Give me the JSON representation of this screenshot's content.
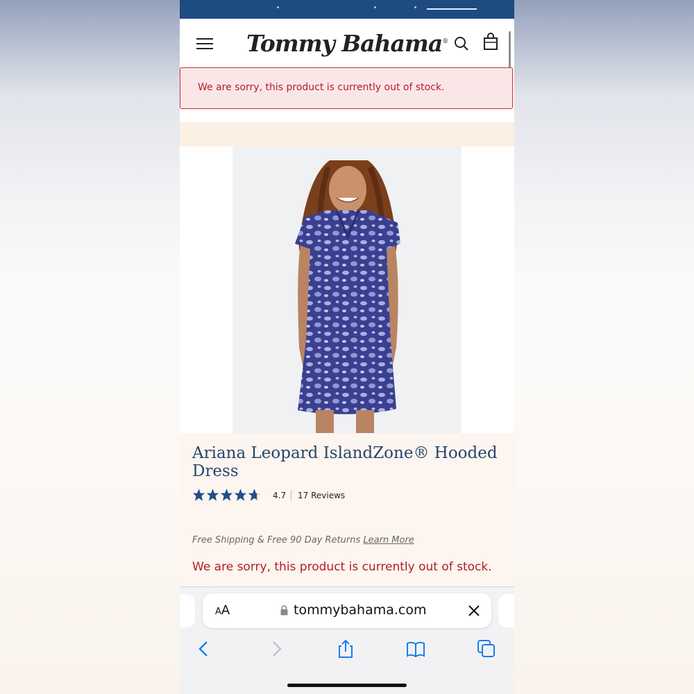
{
  "promo": {
    "link_hint": ""
  },
  "header": {
    "logo_text": "Tommy Bahama",
    "logo_mark": "®",
    "icons": {
      "menu": "hamburger-menu-icon",
      "search": "search-icon",
      "bag": "shopping-bag-icon"
    }
  },
  "alert_banner": {
    "message": "We are sorry, this product is currently out of stock."
  },
  "product": {
    "title": "Ariana Leopard IslandZone® Hooded Dress",
    "rating": {
      "value": "4.7",
      "stars_filled": 4.7,
      "stars_total": 5,
      "reviews": "17 Reviews"
    },
    "shipping": {
      "text": "Free Shipping & Free 90 Day Returns",
      "link": "Learn More"
    },
    "stock_message": "We are sorry, this product is currently out of stock."
  },
  "browser": {
    "text_size_label_small": "A",
    "text_size_label_large": "A",
    "url": "tommybahama.com",
    "icons": {
      "lock": "lock-icon",
      "close": "close-icon",
      "back": "back-chevron-icon",
      "forward": "forward-chevron-icon",
      "share": "share-icon",
      "bookmarks": "bookmarks-book-icon",
      "tabs": "tabs-icon"
    }
  },
  "colors": {
    "brand_navy": "#1e4b80",
    "title_blue": "#25456f",
    "error_red": "#b21d26",
    "alert_bg": "#fbe6e7",
    "ios_blue": "#1a7cf0"
  }
}
